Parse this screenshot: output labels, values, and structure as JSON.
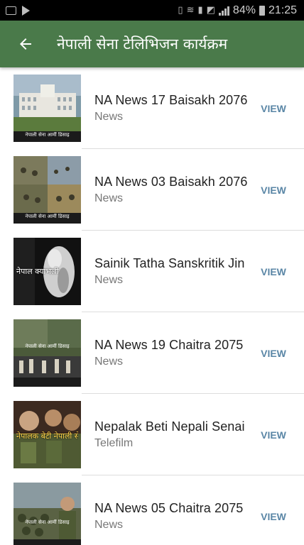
{
  "status_bar": {
    "battery": "84%",
    "time": "21:25"
  },
  "app_bar": {
    "title": "नेपाली सेना टेलिभिजन कार्यक्रम",
    "back_icon": "arrow-left-icon",
    "background": "#4a7a4a"
  },
  "list": {
    "items": [
      {
        "title": "NA News 17 Baisakh 2076",
        "category": "News",
        "view_label": "VIEW",
        "thumb_caption": "नेपाली सेना आर्मी डिसाइ"
      },
      {
        "title": "NA News 03 Baisakh 2076",
        "category": "News",
        "view_label": "VIEW",
        "thumb_caption": "नेपाली सेना आर्मी डिसाइ"
      },
      {
        "title": "Sainik Tatha Sanskritik Jin",
        "category": "News",
        "view_label": "VIEW",
        "thumb_caption": "नेपाल क्याभल्री"
      },
      {
        "title": "NA News 19 Chaitra 2075",
        "category": "News",
        "view_label": "VIEW",
        "thumb_caption": "नेपाली सेना आर्मी डिसाइ"
      },
      {
        "title": "Nepalak Beti Nepali Senai",
        "category": "Telefilm",
        "view_label": "VIEW",
        "thumb_caption": "नेपालक बेटी नेपाली सेना"
      },
      {
        "title": "NA News 05 Chaitra 2075",
        "category": "News",
        "view_label": "VIEW",
        "thumb_caption": "नेपाली सेना आर्मी डिसाइ"
      }
    ]
  },
  "colors": {
    "view_text": "#5a86a6",
    "title_text": "#222222",
    "category_text": "#777777"
  }
}
